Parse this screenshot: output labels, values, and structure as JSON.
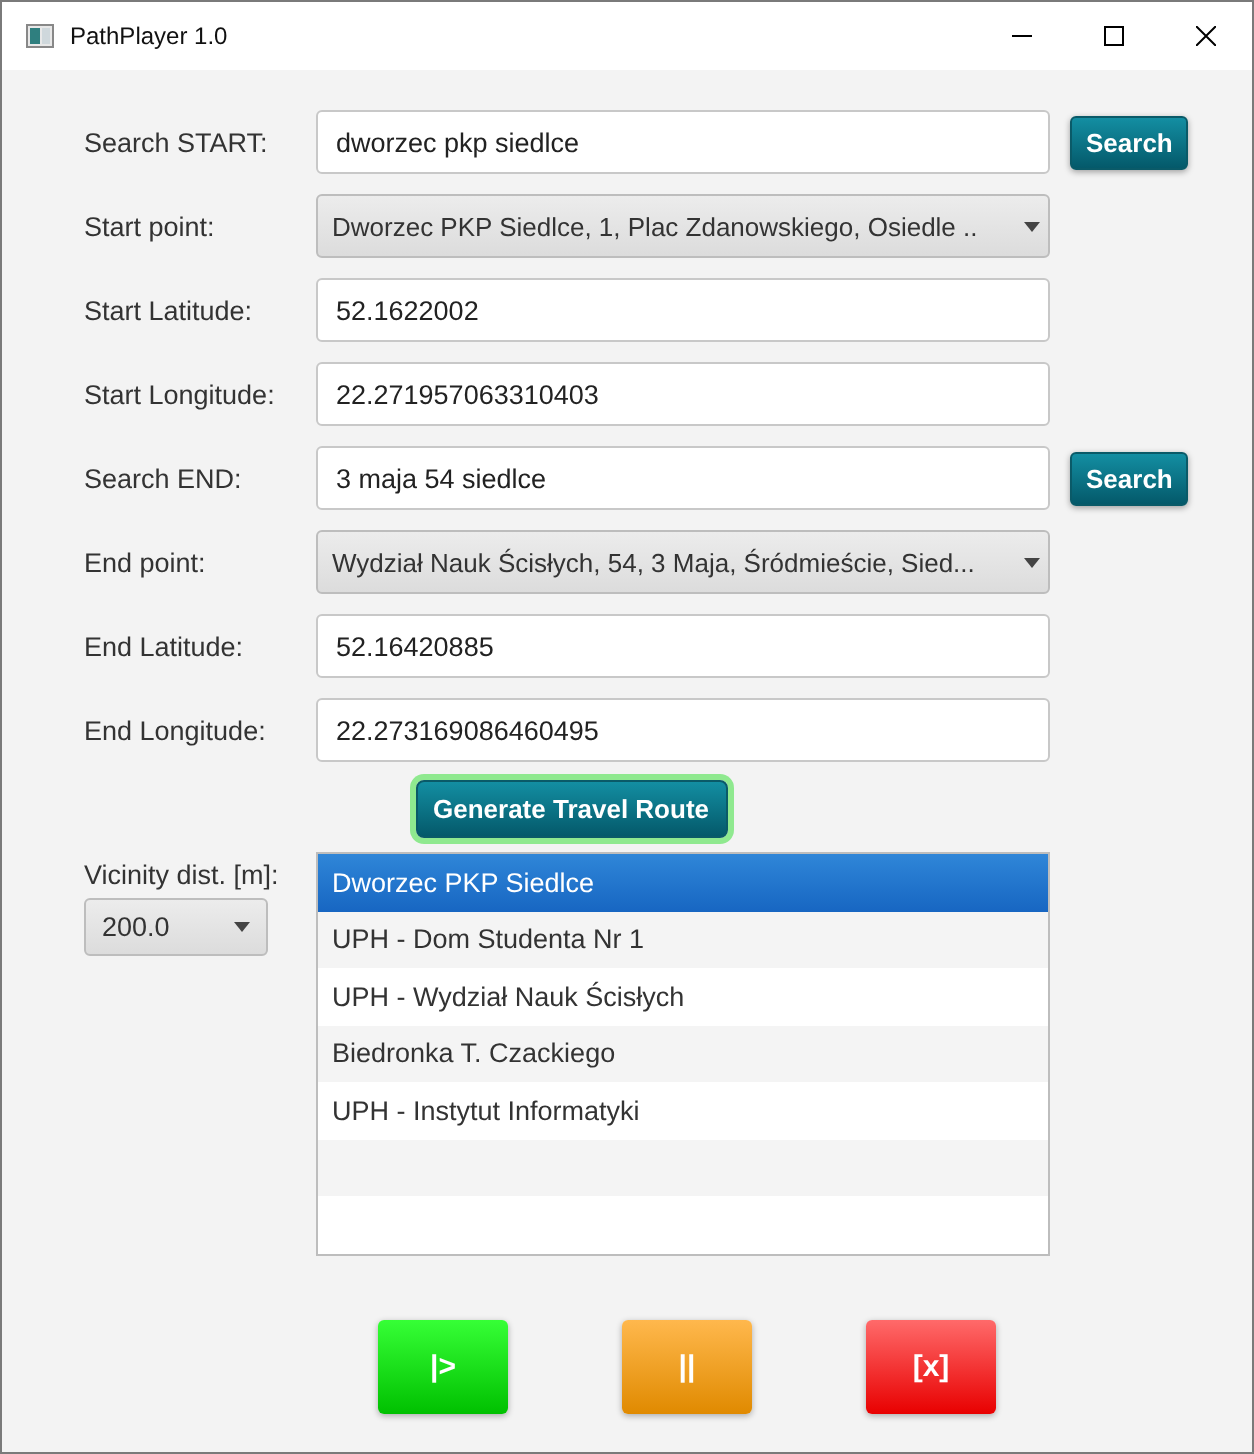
{
  "window": {
    "title": "PathPlayer 1.0"
  },
  "fields": [
    {
      "label": "Search START:",
      "kind": "text",
      "value": "dworzec pkp siedlce",
      "button": "Search"
    },
    {
      "label": "Start point:",
      "kind": "combo",
      "value": "Dworzec PKP Siedlce, 1, Plac Zdanowskiego, Osiedle .."
    },
    {
      "label": "Start Latitude:",
      "kind": "text",
      "value": "52.1622002"
    },
    {
      "label": "Start Longitude:",
      "kind": "text",
      "value": "22.271957063310403"
    },
    {
      "label": "Search END:",
      "kind": "text",
      "value": "3 maja 54 siedlce",
      "button": "Search"
    },
    {
      "label": "End point:",
      "kind": "combo",
      "value": "Wydział Nauk Ścisłych, 54, 3 Maja, Śródmieście, Sied..."
    },
    {
      "label": "End Latitude:",
      "kind": "text",
      "value": "52.16420885"
    },
    {
      "label": "End Longitude:",
      "kind": "text",
      "value": "22.273169086460495"
    }
  ],
  "generate_button": "Generate Travel Route",
  "vicinity": {
    "label": "Vicinity dist. [m]:",
    "value": "200.0"
  },
  "places": [
    {
      "name": "Dworzec PKP Siedlce",
      "selected": true
    },
    {
      "name": "UPH - Dom Studenta Nr 1",
      "selected": false
    },
    {
      "name": "UPH - Wydział Nauk Ścisłych",
      "selected": false
    },
    {
      "name": "Biedronka T. Czackiego",
      "selected": false
    },
    {
      "name": "UPH - Instytut Informatyki",
      "selected": false
    }
  ],
  "controls": [
    {
      "label": "|>",
      "kind": "play"
    },
    {
      "label": "||",
      "kind": "pause"
    },
    {
      "label": "[x]",
      "kind": "stop"
    }
  ]
}
